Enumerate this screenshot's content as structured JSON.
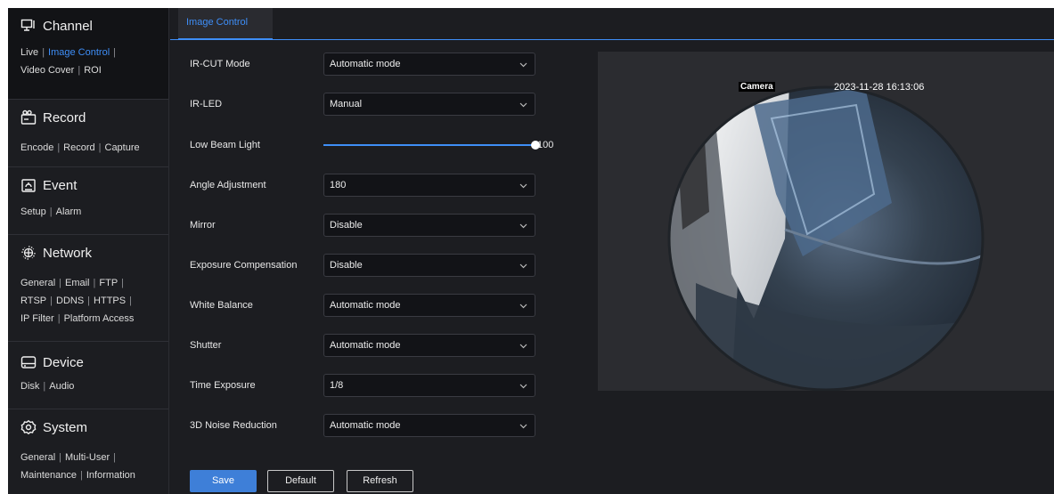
{
  "sidebar": {
    "sections": [
      {
        "title": "Channel",
        "icon": "monitor-icon",
        "rows": [
          [
            "Live",
            "Image Control"
          ],
          [
            "Video Cover",
            "ROI"
          ]
        ]
      },
      {
        "title": "Record",
        "icon": "camera-icon",
        "rows": [
          [
            "Encode",
            "Record",
            "Capture"
          ]
        ]
      },
      {
        "title": "Event",
        "icon": "alarm-icon",
        "rows": [
          [
            "Setup",
            "Alarm"
          ]
        ]
      },
      {
        "title": "Network",
        "icon": "globe-icon",
        "rows": [
          [
            "General",
            "Email",
            "FTP"
          ],
          [
            "RTSP",
            "DDNS",
            "HTTPS"
          ],
          [
            "IP Filter",
            "Platform Access"
          ]
        ]
      },
      {
        "title": "Device",
        "icon": "hard-drive-icon",
        "rows": [
          [
            "Disk",
            "Audio"
          ]
        ]
      },
      {
        "title": "System",
        "icon": "gear-icon",
        "rows": [
          [
            "General",
            "Multi-User"
          ],
          [
            "Maintenance",
            "Information"
          ]
        ]
      }
    ]
  },
  "tab": {
    "label": "Image Control"
  },
  "form": {
    "ircut": {
      "label": "IR-CUT Mode",
      "value": "Automatic mode"
    },
    "irled": {
      "label": "IR-LED",
      "value": "Manual"
    },
    "lowbeam": {
      "label": "Low Beam Light",
      "value": "100",
      "level": 100
    },
    "angle": {
      "label": "Angle Adjustment",
      "value": "180"
    },
    "mirror": {
      "label": "Mirror",
      "value": "Disable"
    },
    "exposure": {
      "label": "Exposure Compensation",
      "value": "Disable"
    },
    "whitebalance": {
      "label": "White Balance",
      "value": "Automatic mode"
    },
    "shutter": {
      "label": "Shutter",
      "value": "Automatic mode"
    },
    "timeexposure": {
      "label": "Time Exposure",
      "value": "1/8"
    },
    "noise": {
      "label": "3D Noise Reduction",
      "value": "Automatic mode"
    }
  },
  "buttons": {
    "save": "Save",
    "default": "Default",
    "refresh": "Refresh"
  },
  "preview": {
    "camera_name": "Camera",
    "timestamp": "2023-11-28 16:13:06"
  },
  "colors": {
    "accent": "#3e8ef7",
    "background": "#1c1d21",
    "panel": "#121316"
  }
}
